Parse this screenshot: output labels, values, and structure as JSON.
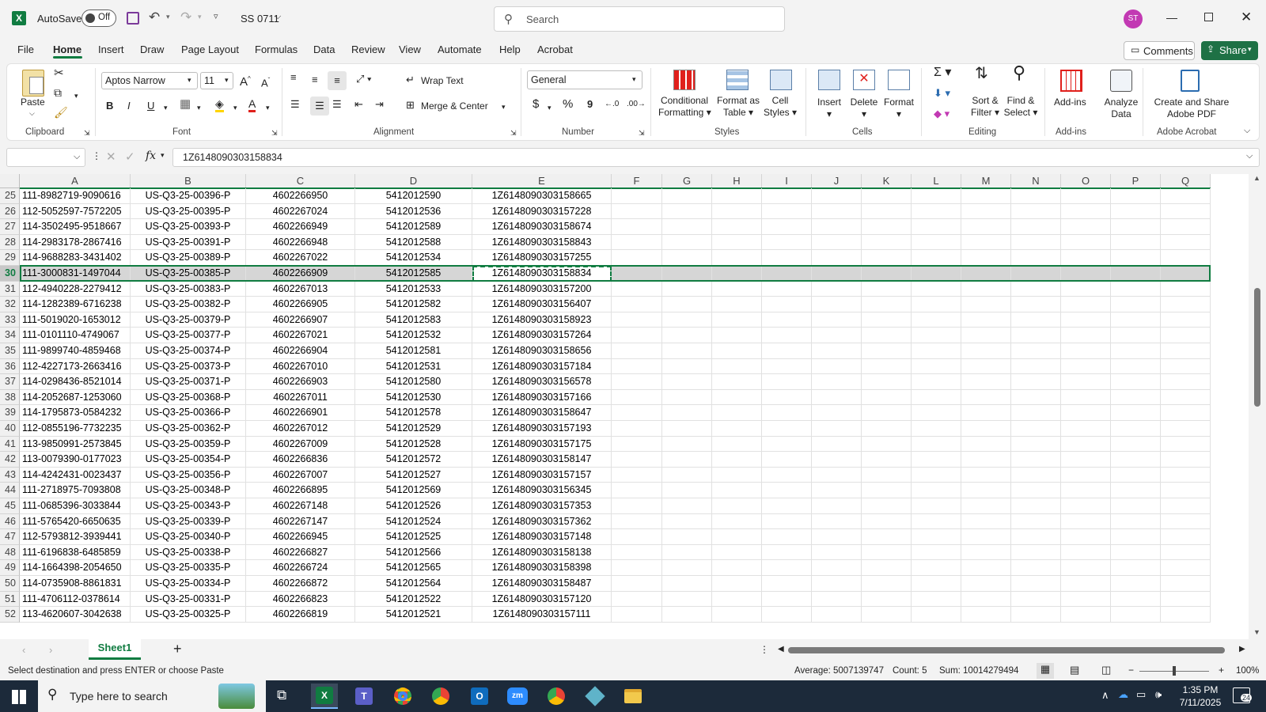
{
  "title_bar": {
    "autosave_label": "AutoSave",
    "autosave_state": "Off",
    "file_name": "SS 0711",
    "search_placeholder": "Search",
    "user_initials": "ST"
  },
  "tabs": [
    "File",
    "Home",
    "Insert",
    "Draw",
    "Page Layout",
    "Formulas",
    "Data",
    "Review",
    "View",
    "Automate",
    "Help",
    "Acrobat"
  ],
  "active_tab": "Home",
  "comments_label": "Comments",
  "share_label": "Share",
  "ribbon": {
    "clipboard": {
      "paste": "Paste",
      "group": "Clipboard"
    },
    "font": {
      "family": "Aptos Narrow",
      "size": "11",
      "bold": "B",
      "italic": "I",
      "underline": "U",
      "group": "Font"
    },
    "alignment": {
      "wrap_text": "Wrap Text",
      "merge_center": "Merge & Center",
      "group": "Alignment"
    },
    "number": {
      "format": "General",
      "currency": "$",
      "percent": "%",
      "comma": "9",
      "group": "Number"
    },
    "styles": {
      "conditional": "Conditional",
      "conditional2": "Formatting",
      "format_table": "Format as",
      "format_table2": "Table",
      "cell_styles": "Cell",
      "cell_styles2": "Styles",
      "group": "Styles"
    },
    "cells": {
      "insert": "Insert",
      "delete": "Delete",
      "format": "Format",
      "group": "Cells"
    },
    "editing": {
      "sort": "Sort &",
      "sort2": "Filter",
      "find": "Find &",
      "find2": "Select",
      "group": "Editing"
    },
    "addins": {
      "addins": "Add-ins",
      "analyze": "Analyze",
      "analyze2": "Data",
      "group": "Add-ins"
    },
    "acrobat": {
      "create": "Create and Share",
      "create2": "Adobe PDF",
      "group": "Adobe Acrobat"
    }
  },
  "formula_bar": {
    "name_box": "",
    "fx": "fx",
    "value": "1Z6148090303158834"
  },
  "columns": [
    "A",
    "B",
    "C",
    "D",
    "E",
    "F",
    "G",
    "H",
    "I",
    "J",
    "K",
    "L",
    "M",
    "N",
    "O",
    "P",
    "Q"
  ],
  "rows": [
    {
      "n": "25",
      "a": "111-8982719-9090616",
      "b": "US-Q3-25-00396-P",
      "c": "4602266950",
      "d": "5412012590",
      "e": "1Z6148090303158665"
    },
    {
      "n": "26",
      "a": "112-5052597-7572205",
      "b": "US-Q3-25-00395-P",
      "c": "4602267024",
      "d": "5412012536",
      "e": "1Z6148090303157228"
    },
    {
      "n": "27",
      "a": "114-3502495-9518667",
      "b": "US-Q3-25-00393-P",
      "c": "4602266949",
      "d": "5412012589",
      "e": "1Z6148090303158674"
    },
    {
      "n": "28",
      "a": "114-2983178-2867416",
      "b": "US-Q3-25-00391-P",
      "c": "4602266948",
      "d": "5412012588",
      "e": "1Z6148090303158843"
    },
    {
      "n": "29",
      "a": "114-9688283-3431402",
      "b": "US-Q3-25-00389-P",
      "c": "4602267022",
      "d": "5412012534",
      "e": "1Z6148090303157255"
    },
    {
      "n": "30",
      "a": "111-3000831-1497044",
      "b": "US-Q3-25-00385-P",
      "c": "4602266909",
      "d": "5412012585",
      "e": "1Z6148090303158834"
    },
    {
      "n": "31",
      "a": "112-4940228-2279412",
      "b": "US-Q3-25-00383-P",
      "c": "4602267013",
      "d": "5412012533",
      "e": "1Z6148090303157200"
    },
    {
      "n": "32",
      "a": "114-1282389-6716238",
      "b": "US-Q3-25-00382-P",
      "c": "4602266905",
      "d": "5412012582",
      "e": "1Z6148090303156407"
    },
    {
      "n": "33",
      "a": "111-5019020-1653012",
      "b": "US-Q3-25-00379-P",
      "c": "4602266907",
      "d": "5412012583",
      "e": "1Z6148090303158923"
    },
    {
      "n": "34",
      "a": "111-0101110-4749067",
      "b": "US-Q3-25-00377-P",
      "c": "4602267021",
      "d": "5412012532",
      "e": "1Z6148090303157264"
    },
    {
      "n": "35",
      "a": "111-9899740-4859468",
      "b": "US-Q3-25-00374-P",
      "c": "4602266904",
      "d": "5412012581",
      "e": "1Z6148090303158656"
    },
    {
      "n": "36",
      "a": "112-4227173-2663416",
      "b": "US-Q3-25-00373-P",
      "c": "4602267010",
      "d": "5412012531",
      "e": "1Z6148090303157184"
    },
    {
      "n": "37",
      "a": "114-0298436-8521014",
      "b": "US-Q3-25-00371-P",
      "c": "4602266903",
      "d": "5412012580",
      "e": "1Z6148090303156578"
    },
    {
      "n": "38",
      "a": "114-2052687-1253060",
      "b": "US-Q3-25-00368-P",
      "c": "4602267011",
      "d": "5412012530",
      "e": "1Z6148090303157166"
    },
    {
      "n": "39",
      "a": "114-1795873-0584232",
      "b": "US-Q3-25-00366-P",
      "c": "4602266901",
      "d": "5412012578",
      "e": "1Z6148090303158647"
    },
    {
      "n": "40",
      "a": "112-0855196-7732235",
      "b": "US-Q3-25-00362-P",
      "c": "4602267012",
      "d": "5412012529",
      "e": "1Z6148090303157193"
    },
    {
      "n": "41",
      "a": "113-9850991-2573845",
      "b": "US-Q3-25-00359-P",
      "c": "4602267009",
      "d": "5412012528",
      "e": "1Z6148090303157175"
    },
    {
      "n": "42",
      "a": "113-0079390-0177023",
      "b": "US-Q3-25-00354-P",
      "c": "4602266836",
      "d": "5412012572",
      "e": "1Z6148090303158147"
    },
    {
      "n": "43",
      "a": "114-4242431-0023437",
      "b": "US-Q3-25-00356-P",
      "c": "4602267007",
      "d": "5412012527",
      "e": "1Z6148090303157157"
    },
    {
      "n": "44",
      "a": "111-2718975-7093808",
      "b": "US-Q3-25-00348-P",
      "c": "4602266895",
      "d": "5412012569",
      "e": "1Z6148090303156345"
    },
    {
      "n": "45",
      "a": "111-0685396-3033844",
      "b": "US-Q3-25-00343-P",
      "c": "4602267148",
      "d": "5412012526",
      "e": "1Z6148090303157353"
    },
    {
      "n": "46",
      "a": "111-5765420-6650635",
      "b": "US-Q3-25-00339-P",
      "c": "4602267147",
      "d": "5412012524",
      "e": "1Z6148090303157362"
    },
    {
      "n": "47",
      "a": "112-5793812-3939441",
      "b": "US-Q3-25-00340-P",
      "c": "4602266945",
      "d": "5412012525",
      "e": "1Z6148090303157148"
    },
    {
      "n": "48",
      "a": "111-6196838-6485859",
      "b": "US-Q3-25-00338-P",
      "c": "4602266827",
      "d": "5412012566",
      "e": "1Z6148090303158138"
    },
    {
      "n": "49",
      "a": "114-1664398-2054650",
      "b": "US-Q3-25-00335-P",
      "c": "4602266724",
      "d": "5412012565",
      "e": "1Z6148090303158398"
    },
    {
      "n": "50",
      "a": "114-0735908-8861831",
      "b": "US-Q3-25-00334-P",
      "c": "4602266872",
      "d": "5412012564",
      "e": "1Z6148090303158487"
    },
    {
      "n": "51",
      "a": "111-4706112-0378614",
      "b": "US-Q3-25-00331-P",
      "c": "4602266823",
      "d": "5412012522",
      "e": "1Z6148090303157120"
    },
    {
      "n": "52",
      "a": "113-4620607-3042638",
      "b": "US-Q3-25-00325-P",
      "c": "4602266819",
      "d": "5412012521",
      "e": "1Z6148090303157111"
    }
  ],
  "selected_row": "30",
  "sheet_tab": "Sheet1",
  "add_sheet": "+",
  "status": {
    "message": "Select destination and press ENTER or choose Paste",
    "average": "Average: 5007139747",
    "count": "Count: 5",
    "sum": "Sum: 10014279494",
    "zoom": "100%"
  },
  "taskbar": {
    "search_placeholder": "Type here to search",
    "time": "1:35 PM",
    "date": "7/11/2025",
    "notifications": "24"
  },
  "colors": {
    "excel_green": "#107c41",
    "selection": "#c8c8c8",
    "accent_green": "#1e7145"
  }
}
